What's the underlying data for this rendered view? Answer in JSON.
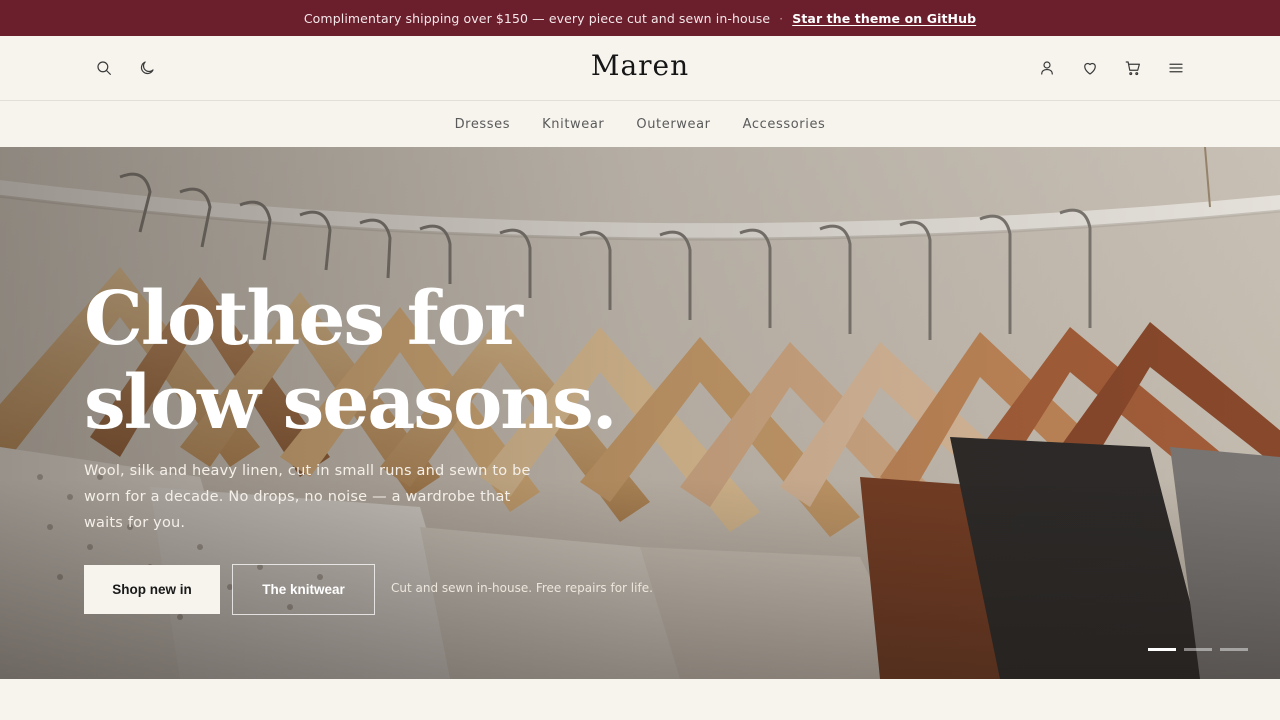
{
  "announcement": {
    "text": "Complimentary shipping over $150 — every piece cut and sewn in-house",
    "separator": "·",
    "link_label": "Star the theme on GitHub",
    "background": "#6b1e2c"
  },
  "header": {
    "logo": "Maren",
    "left_icons": [
      "search-icon",
      "moon-icon"
    ],
    "right_icons": [
      "account-icon",
      "heart-icon",
      "cart-icon",
      "menu-icon"
    ]
  },
  "nav": {
    "items": [
      {
        "label": "Dresses"
      },
      {
        "label": "Knitwear"
      },
      {
        "label": "Outerwear"
      },
      {
        "label": "Accessories"
      }
    ]
  },
  "hero": {
    "title": "Clothes for slow seasons.",
    "subtitle": "Wool, silk and heavy linen, cut in small runs and sewn to be worn for a decade. No drops, no noise — a wardrobe that waits for you.",
    "primary_cta": "Shop new in",
    "secondary_cta": "The knitwear",
    "note": "Cut and sewn in-house. Free repairs for life.",
    "slides": {
      "count": 3,
      "active_index": 0
    }
  },
  "colors": {
    "page_background": "#f7f4ee",
    "accent": "#6b1e2c",
    "text": "#1f1f1f"
  }
}
